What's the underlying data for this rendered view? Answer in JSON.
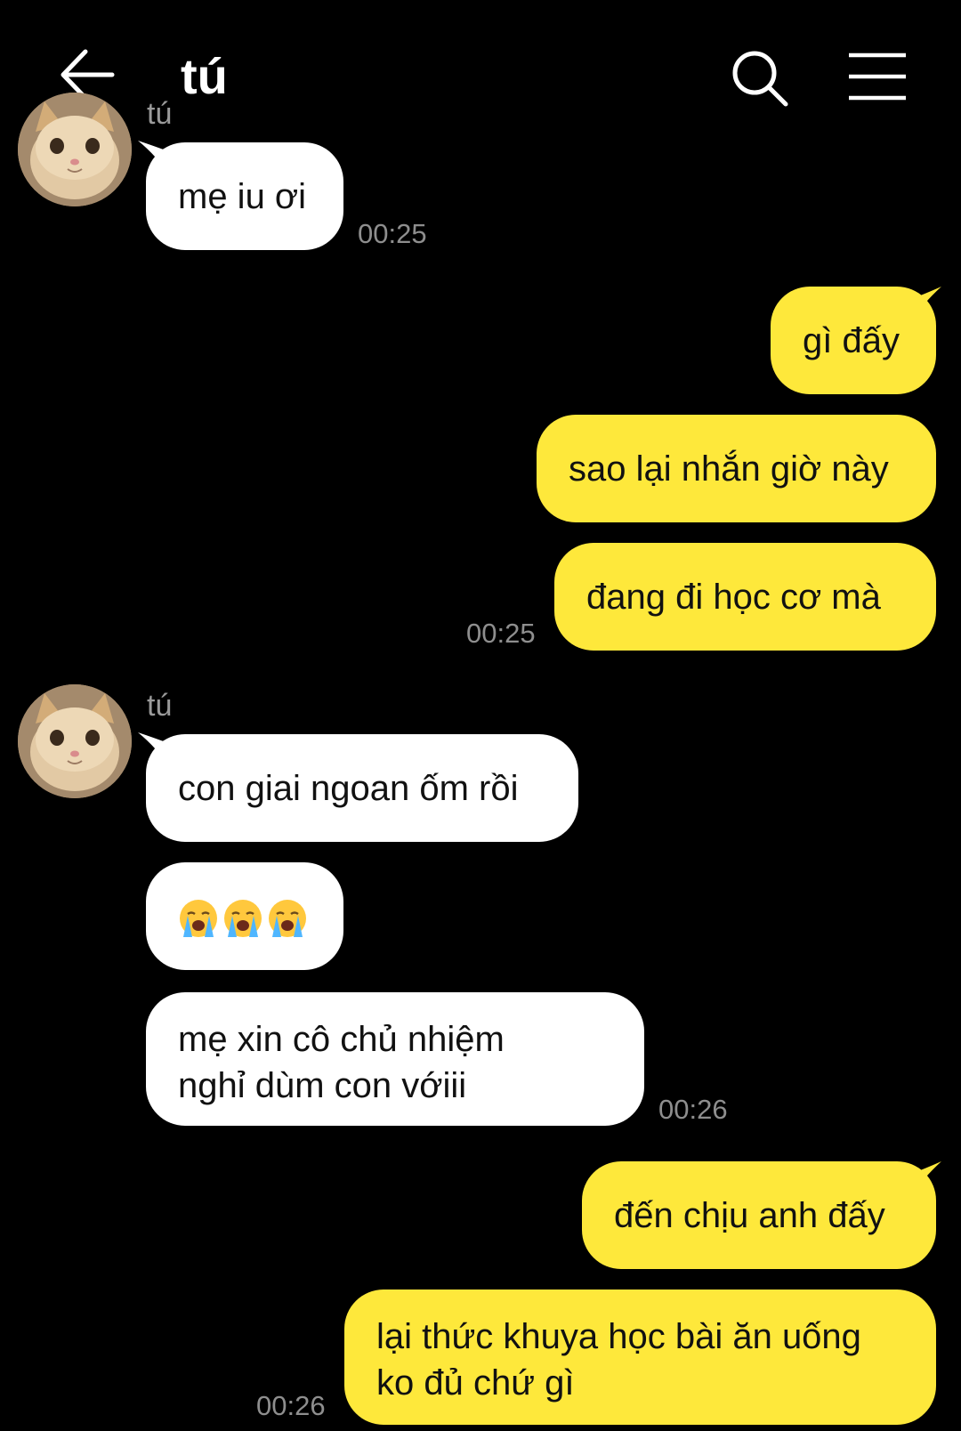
{
  "header": {
    "contact_name": "tú",
    "back_icon": "arrow-left-icon",
    "search_icon": "search-icon",
    "menu_icon": "hamburger-menu-icon"
  },
  "colors": {
    "background": "#000000",
    "incoming_bubble": "#ffffff",
    "outgoing_bubble": "#fee83b",
    "timestamp": "#8e8e8e"
  },
  "messages": {
    "group1": {
      "sender": "tú",
      "m1": "mẹ iu ơi",
      "time": "00:25"
    },
    "group2": {
      "m1": "gì đấy",
      "m2": "sao lại nhắn giờ này",
      "m3": "đang đi học cơ mà",
      "time": "00:25"
    },
    "group3": {
      "sender": "tú",
      "m1": "con giai ngoan ốm rồi",
      "m2_emoji": "loudly-crying-face x3",
      "m3_line1": "mẹ xin cô chủ nhiệm",
      "m3_line2": "nghỉ dùm con vớiii",
      "time": "00:26"
    },
    "group4": {
      "m1": "đến chịu anh đấy",
      "m2_line1": "lại thức khuya học bài ăn uống",
      "m2_line2": "ko đủ chứ gì",
      "time": "00:26"
    }
  }
}
